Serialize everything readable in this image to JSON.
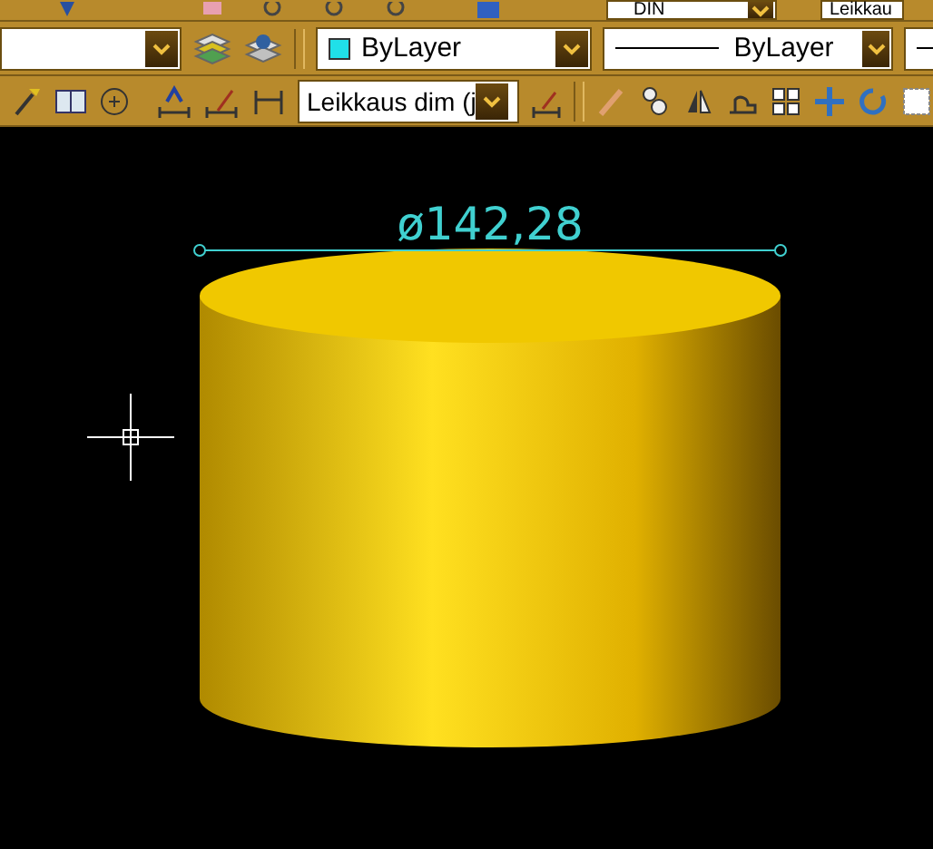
{
  "top_toolbar": {
    "text_style_combo": {
      "value": "DIN"
    },
    "dim_style_combo": {
      "value": "Leikkau"
    }
  },
  "properties_toolbar": {
    "color_combo": {
      "value": "ByLayer"
    },
    "linetype_combo": {
      "value": "ByLayer"
    }
  },
  "dimension_toolbar": {
    "dim_style_combo": {
      "value": "Leikkaus dim (j"
    }
  },
  "drawing": {
    "dimension_text": "ø142,28"
  }
}
